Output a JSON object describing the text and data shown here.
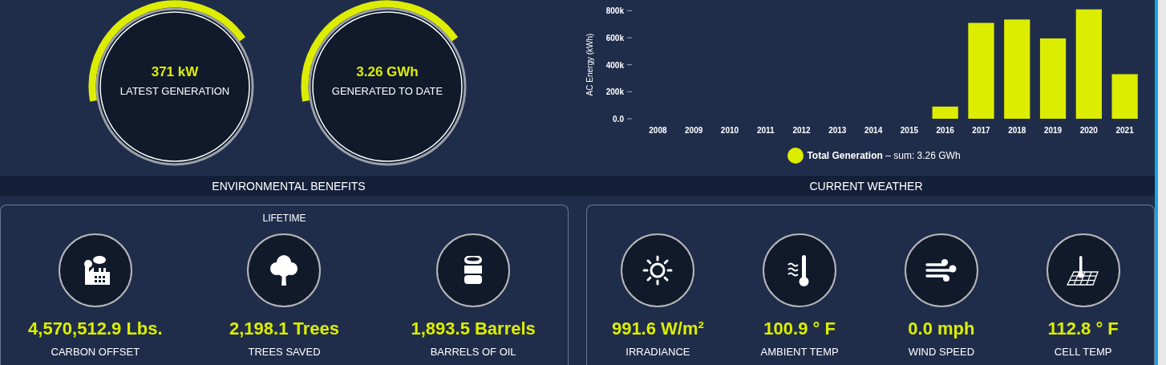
{
  "gauges": [
    {
      "value": "371 kW",
      "label": "LATEST GENERATION"
    },
    {
      "value": "3.26 GWh",
      "label": "GENERATED TO DATE"
    }
  ],
  "chart": {
    "chart_data": {
      "type": "bar",
      "ylabel": "AC Energy (kWh)",
      "categories": [
        "2008",
        "2009",
        "2010",
        "2011",
        "2012",
        "2013",
        "2014",
        "2015",
        "2016",
        "2017",
        "2018",
        "2019",
        "2020",
        "2021"
      ],
      "series": [
        {
          "name": "Total Generation",
          "color": "#dded00",
          "values": [
            0,
            0,
            0,
            0,
            0,
            0,
            0,
            0,
            90000,
            710000,
            735000,
            595000,
            810000,
            330000
          ]
        }
      ],
      "ylim": [
        0,
        820000
      ],
      "yticks": [
        {
          "value": 0,
          "label": "0.0"
        },
        {
          "value": 200000,
          "label": "200k"
        },
        {
          "value": 400000,
          "label": "400k"
        },
        {
          "value": 600000,
          "label": "600k"
        },
        {
          "value": 800000,
          "label": "800k"
        }
      ]
    },
    "legend_suffix": "– sum: 3.26 GWh"
  },
  "sections": [
    {
      "title": "ENVIRONMENTAL BENEFITS",
      "subtitle": "LIFETIME",
      "metrics": [
        {
          "kind": "factory",
          "value": "4,570,512.9 Lbs.",
          "label": "CARBON OFFSET"
        },
        {
          "kind": "tree",
          "value": "2,198.1 Trees",
          "label": "TREES SAVED"
        },
        {
          "kind": "barrel",
          "value": "1,893.5 Barrels",
          "label": "BARRELS OF OIL"
        }
      ]
    },
    {
      "title": "CURRENT WEATHER",
      "metrics": [
        {
          "kind": "sun",
          "value": "991.6 W/m²",
          "label": "IRRADIANCE"
        },
        {
          "kind": "thermometer",
          "value": "100.9 ° F",
          "label": "AMBIENT TEMP"
        },
        {
          "kind": "wind",
          "value": "0.0 mph",
          "label": "WIND SPEED"
        },
        {
          "kind": "panel",
          "value": "112.8 ° F",
          "label": "CELL TEMP"
        }
      ]
    }
  ]
}
